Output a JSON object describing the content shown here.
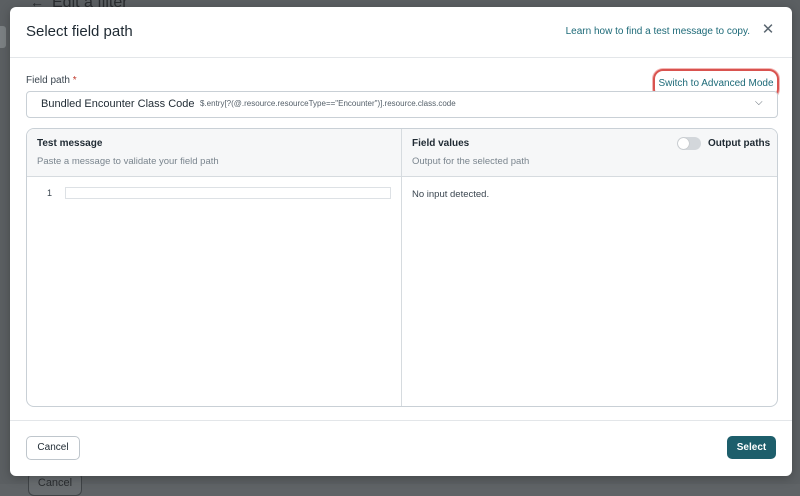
{
  "background": {
    "back_glyph": "←",
    "title": "Edit a filter",
    "cancel_label": "Cancel"
  },
  "modal": {
    "title": "Select field path",
    "learn_link": "Learn how to find a test message to copy.",
    "close_glyph": "✕",
    "field_path_label": "Field path",
    "required_marker": "*",
    "advanced_mode_link": "Switch to Advanced Mode",
    "selected_path": {
      "name": "Bundled Encounter Class Code",
      "expression": "$.entry[?(@.resource.resourceType==\"Encounter\")].resource.class.code",
      "chevron_glyph": "⌵"
    },
    "test_message": {
      "title": "Test message",
      "placeholder": "Paste a message to validate your field path",
      "line_number": "1"
    },
    "field_values": {
      "title": "Field values",
      "subtitle": "Output for the selected path",
      "toggle_label": "Output paths",
      "toggle_on": false,
      "empty_text": "No input detected."
    },
    "footer": {
      "cancel_label": "Cancel",
      "select_label": "Select"
    }
  },
  "colors": {
    "accent": "#1d5e6b",
    "link": "#1d6a78",
    "highlight": "#d9534f"
  }
}
